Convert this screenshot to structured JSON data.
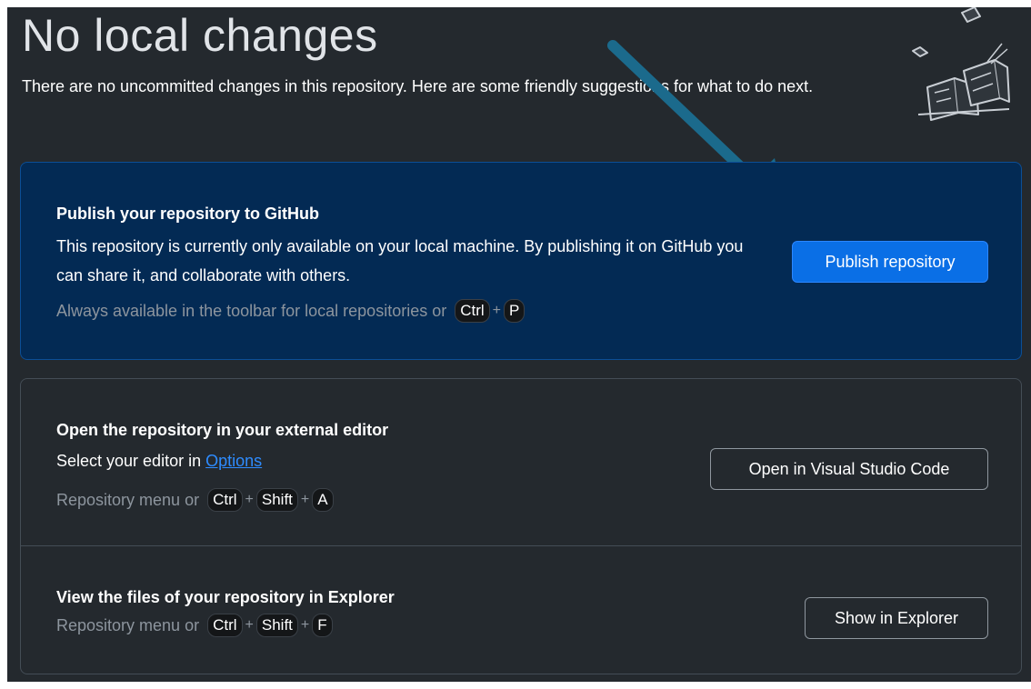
{
  "header": {
    "title": "No local changes",
    "description": "There are no uncommitted changes in this repository. Here are some friendly suggestions for what to do next."
  },
  "publish": {
    "title": "Publish your repository to GitHub",
    "description": "This repository is currently only available on your local machine. By publishing it on GitHub you can share it, and collaborate with others.",
    "hint": "Always available in the toolbar for local repositories or",
    "keys": [
      "Ctrl",
      "P"
    ],
    "button_label": "Publish repository"
  },
  "editor": {
    "title": "Open the repository in your external editor",
    "description_prefix": "Select your editor in",
    "link_label": "Options",
    "hint": "Repository menu or",
    "keys": [
      "Ctrl",
      "Shift",
      "A"
    ],
    "button_label": "Open in Visual Studio Code"
  },
  "explorer": {
    "title": "View the files of your repository in Explorer",
    "hint": "Repository menu or",
    "keys": [
      "Ctrl",
      "Shift",
      "F"
    ],
    "button_label": "Show in Explorer"
  },
  "plus_sign": "+",
  "colors": {
    "background": "#24292e",
    "publish_card": "#032a54",
    "primary_button": "#0a6fe6",
    "link": "#2e8cff",
    "arrow": "#1b6a8c"
  }
}
